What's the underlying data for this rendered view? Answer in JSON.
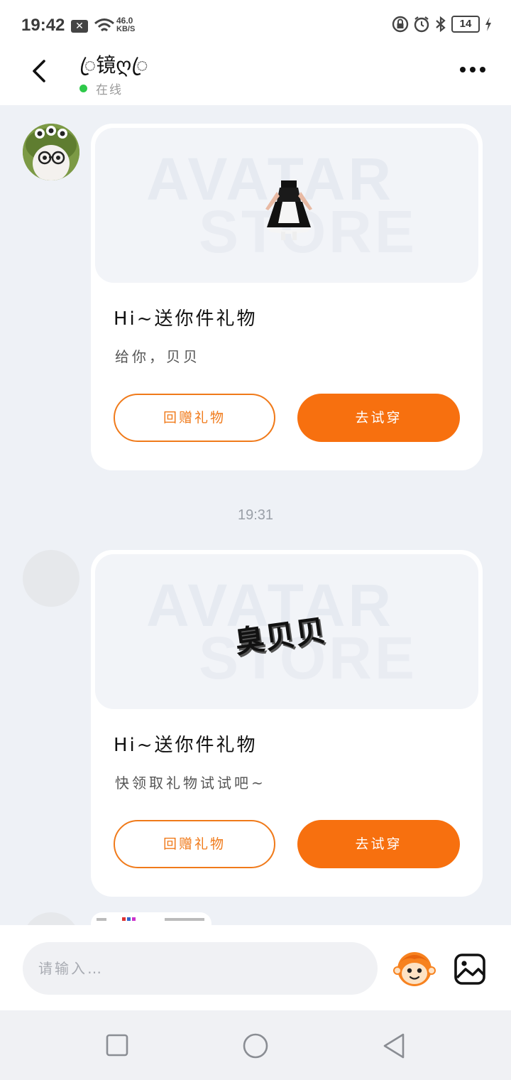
{
  "status_bar": {
    "time": "19:42",
    "x_badge": "✕",
    "net_speed_value": "46.0",
    "net_speed_unit": "KB/S",
    "battery": "14"
  },
  "header": {
    "name": "ꦿ镜ღꦿ",
    "status": "在线"
  },
  "messages": [
    {
      "watermark_line1": "AVATAR",
      "watermark_line2": "STORE",
      "title": "Hi~送你件礼物",
      "text": "给你，贝贝",
      "return_label": "回赠礼物",
      "try_label": "去试穿",
      "preview_icon": "maid-dress-outfit"
    },
    {
      "watermark_line1": "AVATAR",
      "watermark_line2": "STORE",
      "title": "Hi~送你件礼物",
      "text": "快领取礼物试试吧~",
      "return_label": "回赠礼物",
      "try_label": "去试穿",
      "preview_text": "臭贝贝"
    }
  ],
  "timestamp": "19:31",
  "input": {
    "placeholder": "请输入…"
  },
  "colors": {
    "accent": "#f7700f",
    "online": "#2ec94a",
    "background": "#eef1f6"
  },
  "icons": {
    "back": "chevron-left-icon",
    "more": "more-dots-icon",
    "emoji": "cartoon-monkey-emoji-icon",
    "image": "image-icon"
  }
}
